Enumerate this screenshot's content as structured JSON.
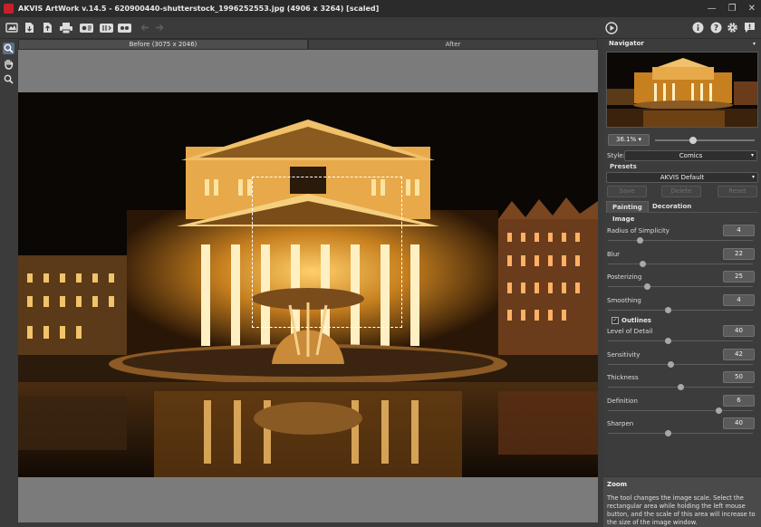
{
  "window": {
    "title": "AKVIS ArtWork v.14.5 - 620900440-shutterstock_1996252553.jpg (4906 x 3264) [scaled]",
    "controls": [
      "—",
      "❐",
      "✕"
    ]
  },
  "toolbar": {
    "buttons": [
      "open-icon",
      "save-icon",
      "export-icon",
      "print-icon",
      "batch-icon",
      "plugin-icon",
      "share-icon",
      "undo-icon",
      "redo-icon"
    ],
    "right": [
      "run-icon",
      "info-icon",
      "help-icon",
      "settings-icon",
      "notifications-icon"
    ]
  },
  "tools": [
    "zoom-tool",
    "hand-tool",
    "magnifier-tool"
  ],
  "tabs": {
    "before": "Before (3075 x 2046)",
    "after": "After"
  },
  "navigator": {
    "title": "Navigator",
    "zoom": "36.1%",
    "zoom_slider_fraction": 0.38
  },
  "settings": {
    "style_label": "Style:",
    "style_value": "Comics",
    "presets_label": "Presets",
    "preset_value": "AKVIS Default",
    "save_label": "Save",
    "delete_label": "Delete",
    "reset_label": "Reset",
    "tab_painting": "Painting",
    "tab_decoration": "Decoration",
    "image_section": "Image",
    "outlines_section": "Outlines",
    "outlines_checked": "✓",
    "params": [
      {
        "name": "Radius of Simplicity",
        "value": "4",
        "fraction": 0.22
      },
      {
        "name": "Blur",
        "value": "22",
        "fraction": 0.24
      },
      {
        "name": "Posterizing",
        "value": "25",
        "fraction": 0.27
      },
      {
        "name": "Smoothing",
        "value": "4",
        "fraction": 0.41
      }
    ],
    "outline_params": [
      {
        "name": "Level of Detail",
        "value": "40",
        "fraction": 0.41
      },
      {
        "name": "Sensitivity",
        "value": "42",
        "fraction": 0.43
      },
      {
        "name": "Thickness",
        "value": "50",
        "fraction": 0.5
      },
      {
        "name": "Definition",
        "value": "6",
        "fraction": 0.76
      },
      {
        "name": "Sharpen",
        "value": "40",
        "fraction": 0.41
      }
    ]
  },
  "help": {
    "title": "Zoom",
    "text": "The tool changes the image scale. Select the rectangular area while holding the left mouse button, and the scale of this area will increase to the size of the image window."
  },
  "colors": {
    "accent": "#5b6f8a",
    "panel": "#3c3c3c",
    "photo_glow": "#f0b347"
  }
}
